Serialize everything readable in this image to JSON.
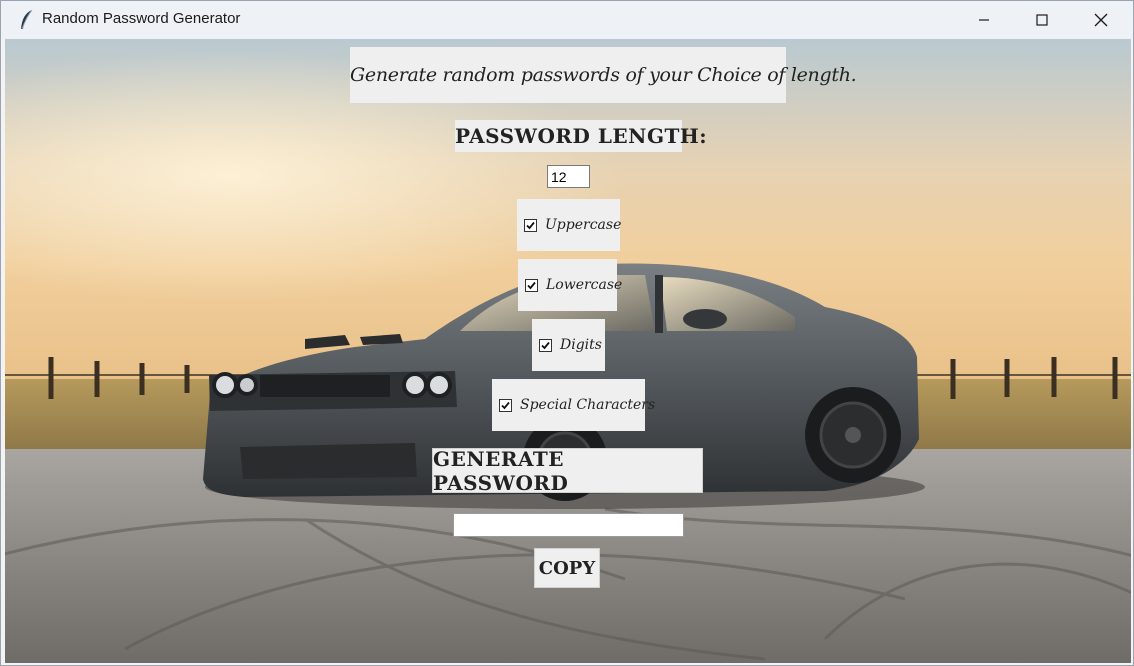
{
  "window": {
    "title": "Random Password Generator",
    "icon": "feather-icon",
    "controls": [
      "minimize-icon",
      "maximize-icon",
      "close-icon"
    ]
  },
  "background": {
    "icon": "muscle-car-photo",
    "sky_color": "#e9c9a0",
    "car_color": "#55595c",
    "road_color": "#8a8783"
  },
  "app": {
    "intro_text": "Generate random passwords of your Choice of length.",
    "length_label": "PASSWORD LENGTH:",
    "length_value": "12",
    "options": {
      "uppercase": {
        "label": "Uppercase",
        "checked": true
      },
      "lowercase": {
        "label": "Lowercase",
        "checked": true
      },
      "digits": {
        "label": "Digits",
        "checked": true
      },
      "special": {
        "label": "Special Characters",
        "checked": true
      }
    },
    "generate_label": "GENERATE PASSWORD",
    "password_value": "",
    "copy_label": "COPY"
  }
}
